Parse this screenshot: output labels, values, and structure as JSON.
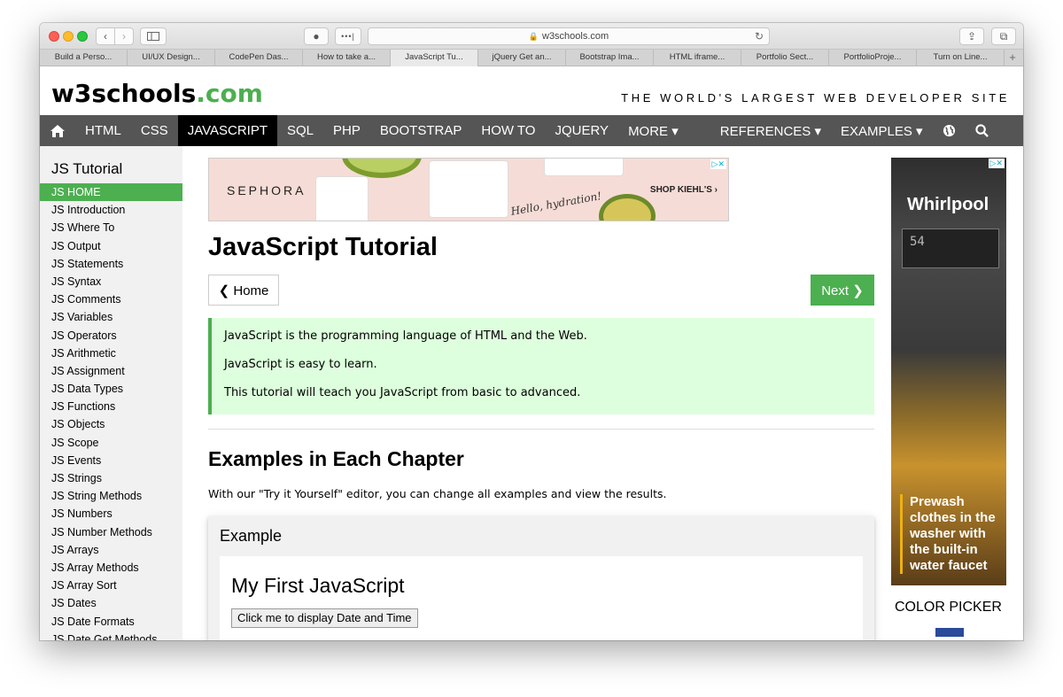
{
  "browser": {
    "address": "w3schools.com",
    "tabs": [
      "Build a Perso...",
      "UI/UX Design...",
      "CodePen Das...",
      "How to take a...",
      "JavaScript Tu...",
      "jQuery Get an...",
      "Bootstrap Ima...",
      "HTML iframe...",
      "Portfolio Sect...",
      "PortfolioProje...",
      "Turn on Line..."
    ],
    "active_tab": 4
  },
  "header": {
    "logo_main": "w3schools",
    "logo_suffix": ".com",
    "tagline": "THE WORLD'S LARGEST WEB DEVELOPER SITE"
  },
  "topnav": {
    "items": [
      "HTML",
      "CSS",
      "JAVASCRIPT",
      "SQL",
      "PHP",
      "BOOTSTRAP",
      "HOW TO",
      "JQUERY",
      "MORE ▾",
      "REFERENCES ▾",
      "EXAMPLES ▾"
    ],
    "active": "JAVASCRIPT"
  },
  "sidebar": {
    "heading": "JS Tutorial",
    "items": [
      "JS HOME",
      "JS Introduction",
      "JS Where To",
      "JS Output",
      "JS Statements",
      "JS Syntax",
      "JS Comments",
      "JS Variables",
      "JS Operators",
      "JS Arithmetic",
      "JS Assignment",
      "JS Data Types",
      "JS Functions",
      "JS Objects",
      "JS Scope",
      "JS Events",
      "JS Strings",
      "JS String Methods",
      "JS Numbers",
      "JS Number Methods",
      "JS Arrays",
      "JS Array Methods",
      "JS Array Sort",
      "JS Dates",
      "JS Date Formats",
      "JS Date Get Methods"
    ],
    "active": "JS HOME"
  },
  "ad_banner": {
    "brand": "SEPHORA",
    "cta": "SHOP KIEHL'S ›",
    "tagline": "Hello, hydration!"
  },
  "main": {
    "title": "JavaScript Tutorial",
    "home_button": "❮ Home",
    "next_button": "Next ❯",
    "intro": [
      "JavaScript is the programming language of HTML and the Web.",
      "JavaScript is easy to learn.",
      "This tutorial will teach you JavaScript from basic to advanced."
    ],
    "section_title": "Examples in Each Chapter",
    "section_desc": "With our \"Try it Yourself\" editor, you can change all examples and view the results.",
    "example": {
      "label": "Example",
      "heading": "My First JavaScript",
      "button": "Click me to display Date and Time"
    }
  },
  "right_ad": {
    "brand": "Whirlpool",
    "display": "54",
    "promo": "Prewash clothes in the washer with the built-in water faucet"
  },
  "color_picker": {
    "title": "COLOR PICKER"
  }
}
